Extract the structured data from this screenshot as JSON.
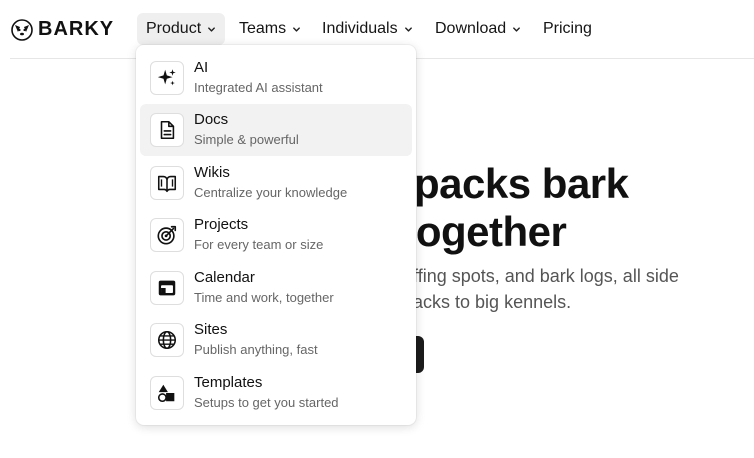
{
  "brand": {
    "name": "BARKY"
  },
  "nav": {
    "items": [
      {
        "label": "Product",
        "has_chevron": true,
        "active": true
      },
      {
        "label": "Teams",
        "has_chevron": true
      },
      {
        "label": "Individuals",
        "has_chevron": true
      },
      {
        "label": "Download",
        "has_chevron": true
      },
      {
        "label": "Pricing",
        "has_chevron": false
      }
    ]
  },
  "hero": {
    "title_line1": "e packs bark",
    "title_line2": ", together",
    "subtitle_line1": ", sniffing spots, and bark logs, all side",
    "subtitle_line2": "all packs to big kennels."
  },
  "product_menu": {
    "items": [
      {
        "label": "AI",
        "description": "Integrated AI assistant",
        "icon": "sparkles-icon"
      },
      {
        "label": "Docs",
        "description": "Simple & powerful",
        "icon": "document-icon",
        "hovered": true
      },
      {
        "label": "Wikis",
        "description": "Centralize your knowledge",
        "icon": "book-icon"
      },
      {
        "label": "Projects",
        "description": "For every team or size",
        "icon": "target-icon"
      },
      {
        "label": "Calendar",
        "description": "Time and work, together",
        "icon": "calendar-icon"
      },
      {
        "label": "Sites",
        "description": "Publish anything, fast",
        "icon": "globe-icon"
      },
      {
        "label": "Templates",
        "description": "Setups to get you started",
        "icon": "shapes-icon"
      }
    ]
  }
}
